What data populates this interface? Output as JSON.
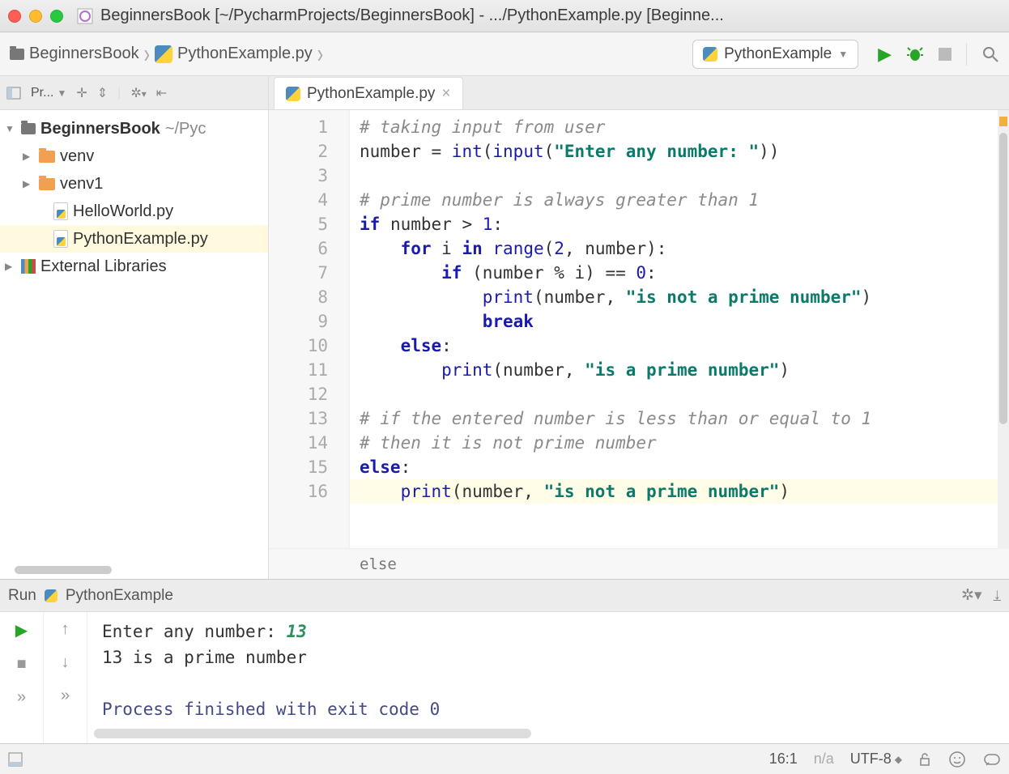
{
  "window": {
    "title": "BeginnersBook [~/PycharmProjects/BeginnersBook] - .../PythonExample.py [Beginne..."
  },
  "breadcrumb": {
    "root": "BeginnersBook",
    "file": "PythonExample.py"
  },
  "run_config": {
    "name": "PythonExample"
  },
  "sidebar": {
    "header_label": "Pr...",
    "project_root": "BeginnersBook",
    "project_path": "~/Pyc",
    "items": [
      {
        "label": "venv",
        "type": "folder"
      },
      {
        "label": "venv1",
        "type": "folder"
      },
      {
        "label": "HelloWorld.py",
        "type": "pyfile"
      },
      {
        "label": "PythonExample.py",
        "type": "pyfile",
        "selected": true
      }
    ],
    "external_label": "External Libraries"
  },
  "editor": {
    "tab_label": "PythonExample.py",
    "line_count": 16,
    "current_line": 16,
    "bottom_crumb": "else",
    "code_tokens": [
      [
        [
          "cm",
          "# taking input from user"
        ]
      ],
      [
        [
          "",
          "number = "
        ],
        [
          "fn",
          "int"
        ],
        [
          "",
          "("
        ],
        [
          "fn",
          "input"
        ],
        [
          "",
          "("
        ],
        [
          "str",
          "\"Enter any number: \""
        ],
        [
          "",
          "))"
        ]
      ],
      [
        [
          "",
          ""
        ]
      ],
      [
        [
          "cm",
          "# prime number is always greater than 1"
        ]
      ],
      [
        [
          "kw",
          "if"
        ],
        [
          "",
          " number > "
        ],
        [
          "num",
          "1"
        ],
        [
          "",
          ":"
        ]
      ],
      [
        [
          "",
          "    "
        ],
        [
          "kw",
          "for"
        ],
        [
          "",
          " i "
        ],
        [
          "kw",
          "in"
        ],
        [
          "",
          " "
        ],
        [
          "fn",
          "range"
        ],
        [
          "",
          "("
        ],
        [
          "num",
          "2"
        ],
        [
          "",
          ", number):"
        ]
      ],
      [
        [
          "",
          "        "
        ],
        [
          "kw",
          "if"
        ],
        [
          "",
          " (number % i) == "
        ],
        [
          "num",
          "0"
        ],
        [
          "",
          ":"
        ]
      ],
      [
        [
          "",
          "            "
        ],
        [
          "fn",
          "print"
        ],
        [
          "",
          "(number, "
        ],
        [
          "str",
          "\"is not a prime number\""
        ],
        [
          "",
          ")"
        ]
      ],
      [
        [
          "",
          "            "
        ],
        [
          "kw",
          "break"
        ]
      ],
      [
        [
          "",
          "    "
        ],
        [
          "kw",
          "else"
        ],
        [
          "",
          ":"
        ]
      ],
      [
        [
          "",
          "        "
        ],
        [
          "fn",
          "print"
        ],
        [
          "",
          "(number, "
        ],
        [
          "str",
          "\"is a prime number\""
        ],
        [
          "",
          ")"
        ]
      ],
      [
        [
          "",
          ""
        ]
      ],
      [
        [
          "cm",
          "# if the entered number is less than or equal to 1"
        ]
      ],
      [
        [
          "cm",
          "# then it is not prime number"
        ]
      ],
      [
        [
          "kw",
          "else"
        ],
        [
          "",
          ":"
        ]
      ],
      [
        [
          "",
          "    "
        ],
        [
          "fn",
          "print"
        ],
        [
          "",
          "(number, "
        ],
        [
          "str",
          "\"is not a prime number\""
        ],
        [
          "",
          ")"
        ]
      ]
    ]
  },
  "run_panel": {
    "label": "Run",
    "config": "PythonExample",
    "console_prompt": "Enter any number: ",
    "console_input": "13",
    "console_output": "13 is a prime number",
    "exit_msg": "Process finished with exit code 0"
  },
  "statusbar": {
    "cursor": "16:1",
    "mode": "n/a",
    "encoding": "UTF-8"
  }
}
